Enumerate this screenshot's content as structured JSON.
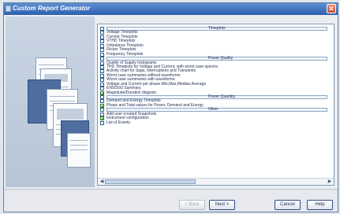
{
  "window": {
    "title": "Custom Report Generator",
    "close_glyph": "✕"
  },
  "list": {
    "items": [
      {
        "type": "header",
        "label": "Timeplots"
      },
      {
        "type": "item",
        "label": "Voltage Timeplots",
        "checked": false
      },
      {
        "type": "item",
        "label": "Current Timeplots",
        "checked": false
      },
      {
        "type": "item",
        "label": "VTHD Timeplots",
        "checked": false
      },
      {
        "type": "item",
        "label": "Unbalance Timeplots",
        "checked": false
      },
      {
        "type": "item",
        "label": "Flicker Timeplots",
        "checked": false
      },
      {
        "type": "item",
        "label": "Frequency Timeplots",
        "checked": false
      },
      {
        "type": "header",
        "label": "Power Quality"
      },
      {
        "type": "item",
        "label": "Quality of Supply histograms",
        "checked": false
      },
      {
        "type": "item",
        "label": "THD Timeplots for Voltage and Current, with worst case spectra",
        "checked": false
      },
      {
        "type": "item",
        "label": "Activity chart for Sags, Interruptions and Transients",
        "checked": false
      },
      {
        "type": "item",
        "label": "Worst case summaries without waveforms",
        "checked": false
      },
      {
        "type": "item",
        "label": "Worst case summaries with waveforms",
        "checked": false
      },
      {
        "type": "item",
        "label": "Voltage and Current per phase Min,Max,Median,Average",
        "checked": false
      },
      {
        "type": "item",
        "label": "EN50160 Summary",
        "checked": false
      },
      {
        "type": "item",
        "label": "Magnitude/Duration diagram",
        "checked": true
      },
      {
        "type": "header",
        "label": "Power Quantity"
      },
      {
        "type": "item",
        "label": "Demand and Energy Timeplots",
        "checked": false
      },
      {
        "type": "item",
        "label": "Phase and Total values for Power, Demand and Energy",
        "checked": true
      },
      {
        "type": "header",
        "label": "Other"
      },
      {
        "type": "item",
        "label": "Add user-created Snapshots",
        "checked": false
      },
      {
        "type": "item",
        "label": "Instrument configuration",
        "checked": true
      },
      {
        "type": "item",
        "label": "List of Events",
        "checked": false
      }
    ]
  },
  "scroll": {
    "left": "◀",
    "right": "▶"
  },
  "buttons": {
    "back": "< Back",
    "next": "Next >",
    "cancel": "Cancel",
    "help": "Help"
  },
  "colors": {
    "title_bar": "#3b6fbf",
    "accent": "#2b4d88"
  }
}
